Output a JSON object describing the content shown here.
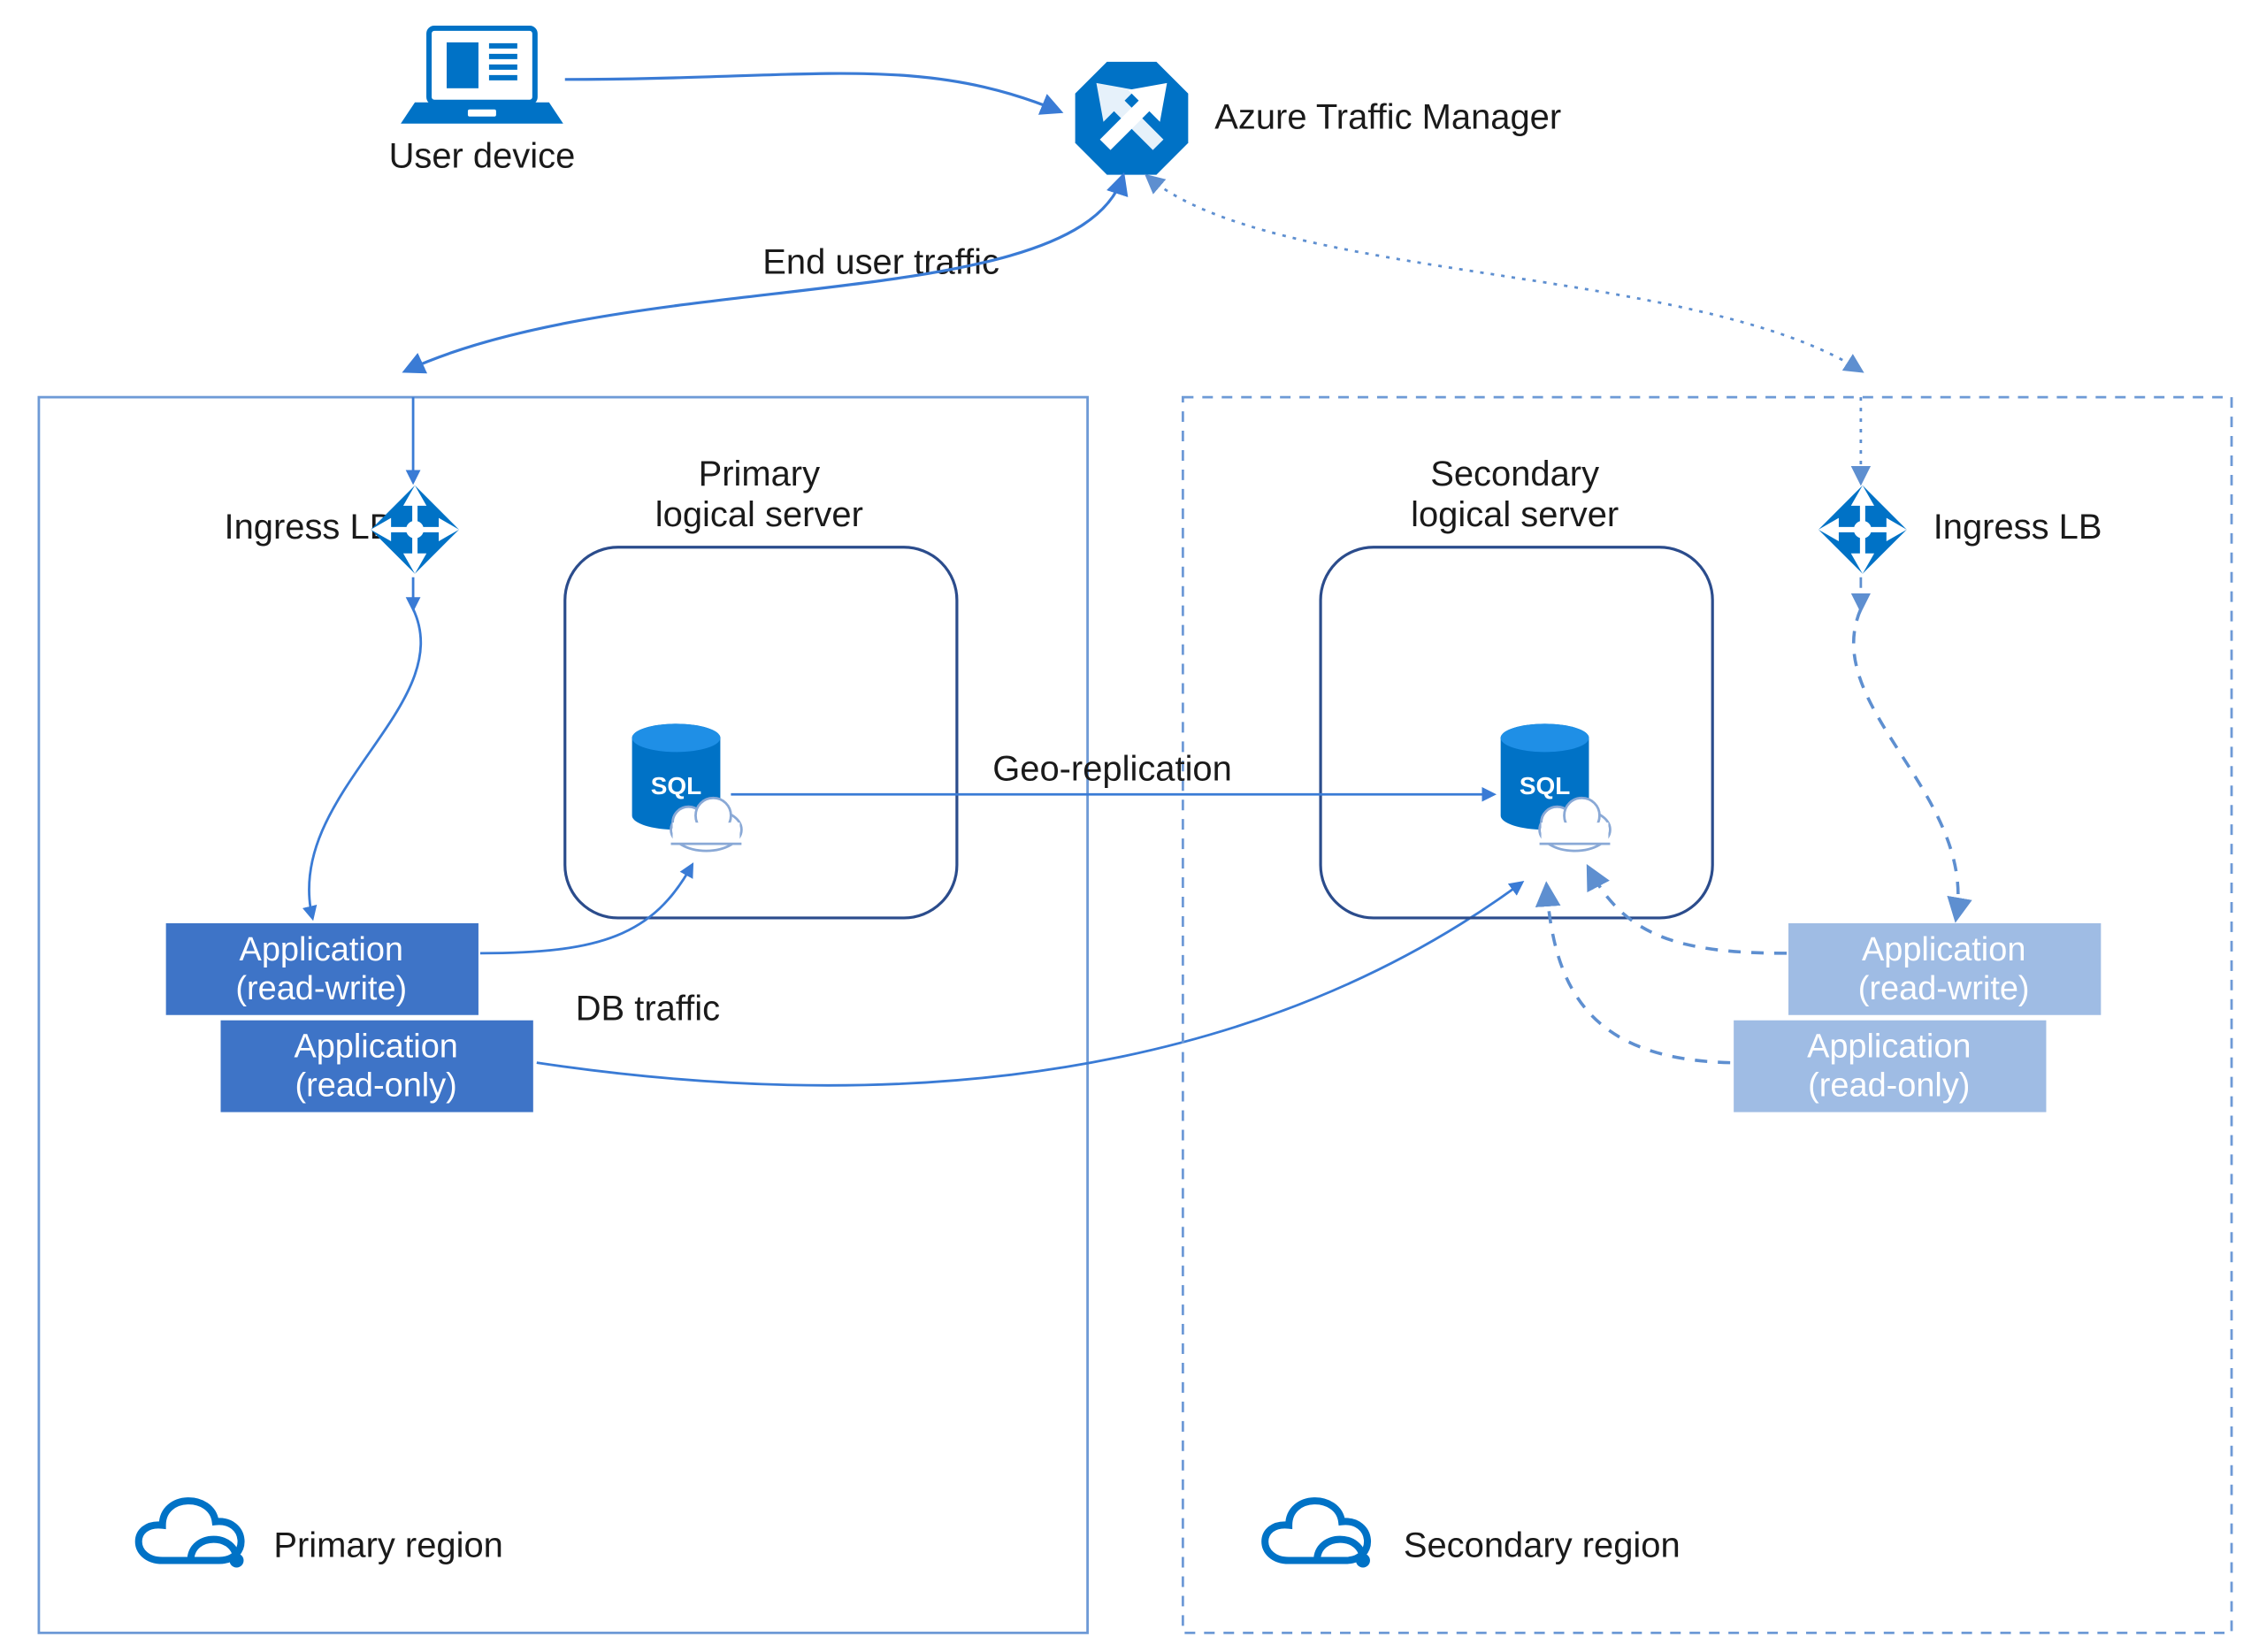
{
  "colors": {
    "azureBlue": "#0072C6",
    "azureBlueBright": "#1E90FF",
    "boxBlue": "#3A7BD5",
    "lightBoxBlue": "#8FB4E3",
    "border": "#4A7FC9",
    "text": "#222222"
  },
  "userDevice": {
    "label": "User device"
  },
  "trafficManager": {
    "label": "Azure Traffic Manager"
  },
  "endUserTraffic": "End user traffic",
  "geoReplication": "Geo-replication",
  "dbTraffic": "DB traffic",
  "primary": {
    "regionLabel": "Primary region",
    "ingressLabel": "Ingress LB",
    "serverLabel": "Primary\nlogical server",
    "app1": {
      "line1": "Application",
      "line2": "(read-write)"
    },
    "app2": {
      "line1": "Application",
      "line2": "(read-only)"
    }
  },
  "secondary": {
    "regionLabel": "Secondary region",
    "ingressLabel": "Ingress LB",
    "serverLabel": "Secondary\nlogical server",
    "app1": {
      "line1": "Application",
      "line2": "(read-write)"
    },
    "app2": {
      "line1": "Application",
      "line2": "(read-only)"
    }
  }
}
